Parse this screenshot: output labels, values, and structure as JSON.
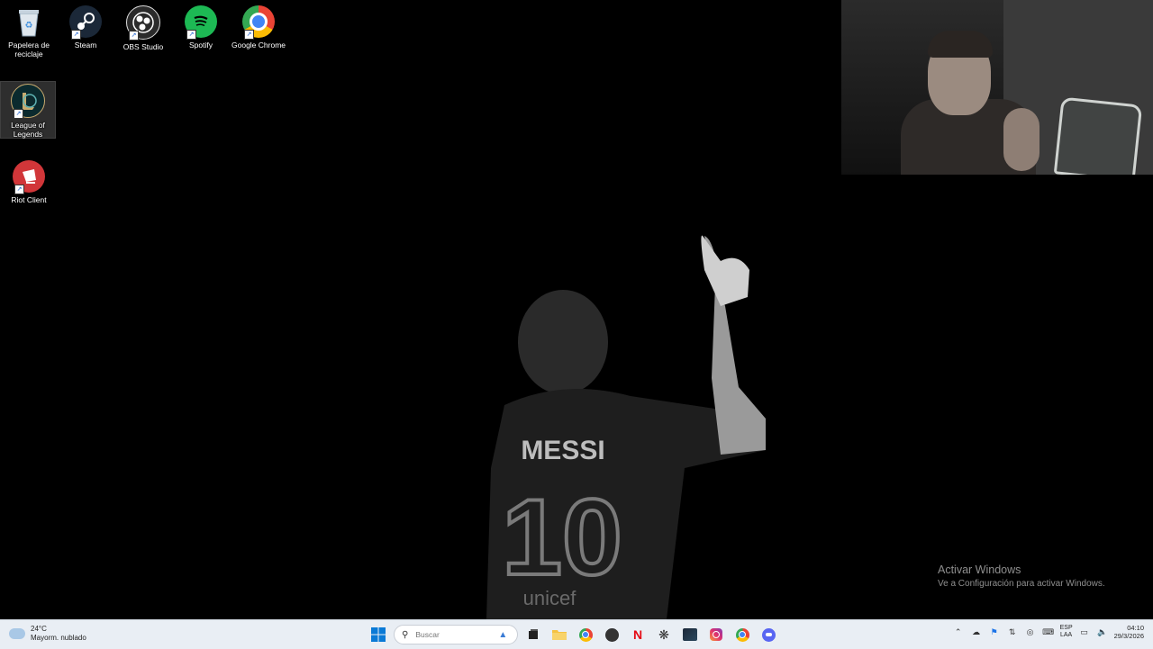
{
  "desktop": {
    "icons": [
      {
        "label": "Papelera de reciclaje",
        "icon": "recycle-bin-icon"
      },
      {
        "label": "Steam",
        "icon": "steam-icon"
      },
      {
        "label": "OBS Studio",
        "icon": "obs-icon"
      },
      {
        "label": "Spotify",
        "icon": "spotify-icon"
      },
      {
        "label": "Google Chrome",
        "icon": "chrome-icon"
      },
      {
        "label": "League of Legends",
        "icon": "league-icon"
      },
      {
        "label": "Riot Client",
        "icon": "riot-icon"
      }
    ]
  },
  "wallpaper": {
    "jersey_name": "MESSI",
    "jersey_number": "10",
    "sponsor": "unicef"
  },
  "watermark": {
    "title": "Activar Windows",
    "subtitle": "Ve a Configuración para activar Windows."
  },
  "taskbar": {
    "weather_temp": "24°C",
    "weather_desc": "Mayorm. nublado",
    "search_placeholder": "Buscar",
    "lang_top": "ESP",
    "lang_bottom": "LAA",
    "time": "04:10",
    "date": "29/3/2026",
    "apps": [
      "start-icon",
      "search-icon",
      "file-explorer-icon",
      "folder-icon",
      "chrome-icon",
      "obs-icon",
      "netflix-icon",
      "chatgpt-icon",
      "steam-icon",
      "instagram-icon",
      "chrome-icon",
      "discord-icon"
    ]
  },
  "colors": {
    "taskbar_bg": "#e9eef4",
    "spotify_green": "#1db954",
    "riot_red": "#d13639",
    "netflix_red": "#e50914"
  }
}
